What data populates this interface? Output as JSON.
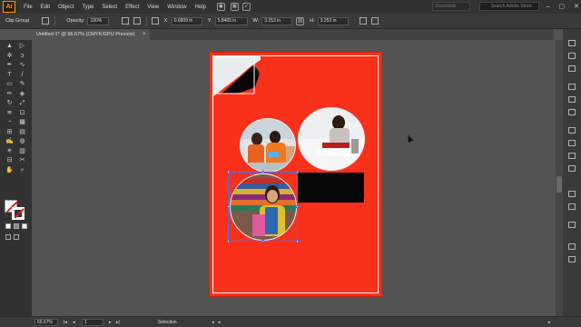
{
  "menubar": {
    "logo": "Ai",
    "items": [
      "File",
      "Edit",
      "Object",
      "Type",
      "Select",
      "Effect",
      "View",
      "Window",
      "Help"
    ],
    "workspace": "Essentials",
    "search_placeholder": "Search Adobe Stock"
  },
  "control_bar": {
    "selection_label": "Clip Group",
    "opacity_label": "Opacity:",
    "opacity_value": "100%",
    "x_label": "X:",
    "x_value": "0.6809 in",
    "y_label": "Y:",
    "y_value": "5.8465 in",
    "w_label": "W:",
    "w_value": "3.253 in",
    "h_label": "H:",
    "h_value": "3.253 in"
  },
  "document_tab": {
    "title": "Untitled-1* @ 66.67% (CMYK/GPU Preview)",
    "close": "×"
  },
  "tools": [
    "selection-tool-icon",
    "direct-selection-tool-icon",
    "magic-wand-icon",
    "lasso-icon",
    "pen-tool-icon",
    "curvature-tool-icon",
    "type-tool-icon",
    "line-tool-icon",
    "rectangle-tool-icon",
    "paintbrush-icon",
    "pencil-icon",
    "eraser-icon",
    "rotate-tool-icon",
    "scale-tool-icon",
    "width-tool-icon",
    "free-transform-icon",
    "shape-builder-icon",
    "perspective-grid-icon",
    "mesh-tool-icon",
    "gradient-tool-icon",
    "eyedropper-icon",
    "blend-tool-icon",
    "symbol-sprayer-icon",
    "column-graph-icon",
    "artboard-tool-icon",
    "slice-tool-icon",
    "hand-tool-icon",
    "zoom-tool-icon"
  ],
  "tool_glyphs": [
    "▲",
    "▷",
    "✲",
    "ↄ",
    "✒",
    "∿",
    "T",
    "/",
    "▭",
    "✎",
    "✏",
    "◈",
    "↻",
    "⤢",
    "≋",
    "⊡",
    "◔",
    "▦",
    "⊞",
    "▤",
    "✍",
    "◍",
    "✳",
    "▥",
    "⊟",
    "✂",
    "✋",
    "⌕"
  ],
  "statusbar": {
    "zoom": "66.67%",
    "artboard_number": "1",
    "tool_name": "Selection"
  },
  "colors": {
    "artboard_red": "#fa311a",
    "selection_blue": "#3d6fff",
    "app_bg": "#535353"
  }
}
